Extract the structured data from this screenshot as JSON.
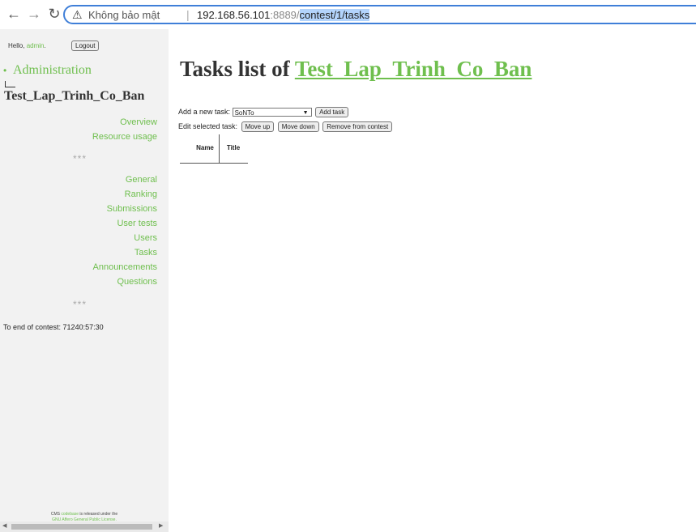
{
  "browser": {
    "security_warning": "Không bảo mật",
    "separator": "|",
    "url_host": "192.168.56.101",
    "url_port": ":8889/",
    "url_path_selected": "contest/1/tasks"
  },
  "sidebar": {
    "hello_prefix": "Hello, ",
    "hello_user": "admin",
    "hello_suffix": ".",
    "logout_label": "Logout",
    "admin_link": "Administration",
    "contest_name": "Test_Lap_Trinh_Co_Ban",
    "menu_top": [
      "Overview",
      "Resource usage"
    ],
    "stars": "***",
    "menu_main": [
      "General",
      "Ranking",
      "Submissions",
      "User tests",
      "Users",
      "Tasks",
      "Announcements",
      "Questions"
    ],
    "countdown": "To end of contest: 71240:57:30",
    "footer_text_1": "CMS ",
    "footer_link": "codebase",
    "footer_text_2": " is released under the",
    "footer_license": "GNU Affero General Public License."
  },
  "main": {
    "title_prefix": "Tasks list of ",
    "title_link": "Test_Lap_Trinh_Co_Ban",
    "add_label": "Add a new task:",
    "add_select_value": "SoNTo",
    "add_button": "Add task",
    "edit_label": "Edit selected task:",
    "move_up": "Move up",
    "move_down": "Move down",
    "remove": "Remove from contest",
    "table_headers": [
      "Name",
      "Title"
    ]
  }
}
